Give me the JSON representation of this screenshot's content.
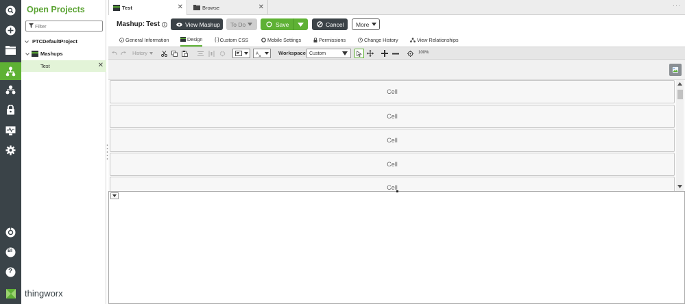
{
  "app": {
    "brand": "thingworx",
    "accent": "#5eb134",
    "rail_color": "#3a4348"
  },
  "rail": {
    "icons": [
      "search-icon",
      "add-icon",
      "browse-icon",
      "projects-icon",
      "composer-icon",
      "security-icon",
      "monitoring-icon",
      "settings-icon",
      "help-center-icon",
      "analytics-icon",
      "help-icon"
    ],
    "analytics_label": "BI",
    "help_label": "?"
  },
  "projects": {
    "title": "Open Projects",
    "filter_placeholder": "Filter",
    "tree": {
      "project": "PTCDefaultProject",
      "group": "Mashups",
      "item": "Test",
      "item_close": "✕"
    }
  },
  "tabs": [
    {
      "label": "Test",
      "close": "✕",
      "active": true
    },
    {
      "label": "Browse",
      "close": "✕",
      "active": false
    }
  ],
  "tabbar_more": "···",
  "header": {
    "title_prefix": "Mashup:",
    "title_name": "Test",
    "view_mashup": "View Mashup",
    "todo": "To Do",
    "save": "Save",
    "cancel": "Cancel",
    "more": "More"
  },
  "subtabs": [
    "General Information",
    "Design",
    "Custom CSS",
    "Mobile Settings",
    "Permissions",
    "Change History",
    "View Relationships"
  ],
  "toolbar": {
    "history": "History",
    "workspace_label": "Workspace",
    "workspace_value": "Custom",
    "zoom": "100%"
  },
  "list": {
    "cells": [
      "Cell",
      "Cell",
      "Cell",
      "Cell",
      "Cell"
    ]
  }
}
